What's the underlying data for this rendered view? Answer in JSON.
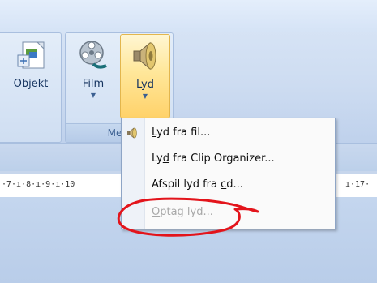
{
  "ribbon": {
    "buttons": [
      {
        "id": "objekt",
        "label": "Objekt"
      },
      {
        "id": "film",
        "label": "Film"
      },
      {
        "id": "lyd",
        "label": "Lyd"
      }
    ],
    "group_label": "Medi"
  },
  "ruler": {
    "left_text": "·7·ı·8·ı·9·ı·10",
    "right_text": "ı·17·"
  },
  "menu": {
    "items": [
      {
        "pre": "",
        "u": "L",
        "post": "yd fra fil...",
        "enabled": true
      },
      {
        "pre": "Ly",
        "u": "d",
        "post": " fra Clip Organizer...",
        "enabled": true
      },
      {
        "pre": "Afspil lyd fra ",
        "u": "c",
        "post": "d...",
        "enabled": true
      },
      {
        "pre": "",
        "u": "O",
        "post": "ptag lyd...",
        "enabled": false
      }
    ]
  },
  "colors": {
    "accent_active": "#ffd26a",
    "annotation": "#e3141b",
    "disabled_text": "#a8a8a8"
  }
}
